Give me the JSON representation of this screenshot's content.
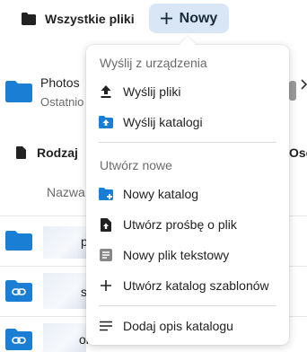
{
  "breadcrumb": {
    "label": "Wszystkie pliki"
  },
  "new_button": {
    "label": "Nowy"
  },
  "background": {
    "folder_name": "Photos",
    "folder_subtitle": "Ostatnio",
    "filter_type_label": "Rodzaj",
    "filter_people_label": "Oso",
    "column_name_label": "Nazwa",
    "row_texts": [
      "p",
      "s",
      "ok"
    ]
  },
  "menu": {
    "upload_caption": "Wyślij z urządzenia",
    "upload_files": "Wyślij pliki",
    "upload_folders": "Wyślij katalogi",
    "create_caption": "Utwórz nowe",
    "new_folder": "Nowy katalog",
    "file_request": "Utwórz prośbę o plik",
    "new_text_file": "Nowy plik tekstowy",
    "template_folder": "Utwórz katalog szablonów",
    "folder_description": "Dodaj opis katalogu"
  },
  "colors": {
    "accent_folder": "#1a7fd4",
    "new_button_bg": "#d8e6f5",
    "text_file_icon": "#888888"
  }
}
